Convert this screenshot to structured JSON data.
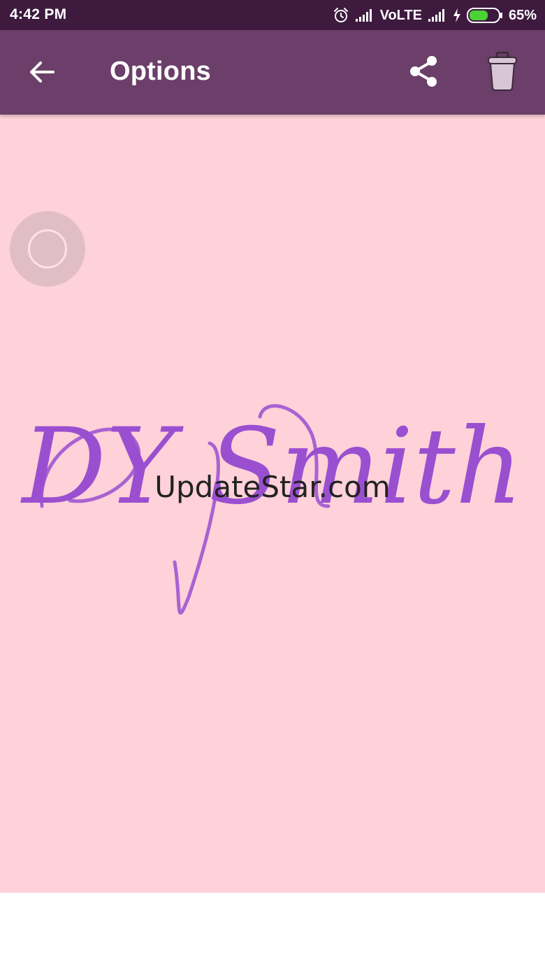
{
  "status_bar": {
    "time": "4:42 PM",
    "network_label": "VoLTE",
    "battery_percent": "65%",
    "battery_level": 0.65,
    "icons": [
      "alarm-icon",
      "signal-icon",
      "signal-icon",
      "charging-icon",
      "battery-icon"
    ]
  },
  "app_bar": {
    "title": "Options",
    "back_icon": "arrow-back-icon",
    "share_icon": "share-icon",
    "delete_icon": "trash-icon"
  },
  "canvas": {
    "signature_text": "DY Smith",
    "watermark": "UpdateStar.com",
    "floating_icon": "circle-icon"
  },
  "colors": {
    "status_bar": "#3e1a3f",
    "app_bar": "#6b3f69",
    "canvas_background": "#ffd1d9",
    "signature_ink": "#9a4fd0",
    "battery_fill": "#4cd137"
  }
}
